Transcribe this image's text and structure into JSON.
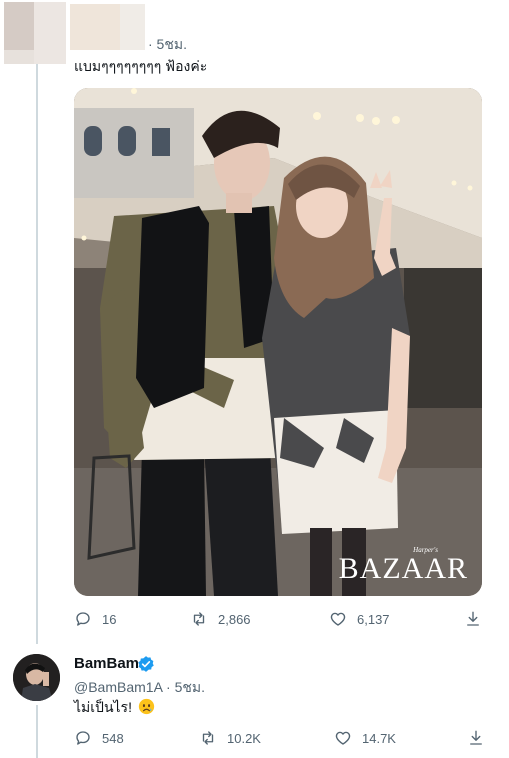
{
  "tweet1": {
    "time": "· 5ชม.",
    "text": "แบมๆๆๆๆๆๆๆๆ ฟ้องค่ะ",
    "image_watermark": "BAZAAR",
    "image_watermark_small": "Harper's",
    "actions": {
      "reply_count": "16",
      "retweet_count": "2,866",
      "like_count": "6,137"
    }
  },
  "tweet2": {
    "name": "BamBam",
    "handle_time": "@BamBam1A · 5ชม.",
    "text": "ไม่เป็นไร!",
    "actions": {
      "reply_count": "548",
      "retweet_count": "10.2K",
      "like_count": "14.7K"
    }
  },
  "colors": {
    "text_primary": "#0f1419",
    "text_secondary": "#536471",
    "verified_blue": "#1d9bf0",
    "thread_line": "#cfd9de"
  },
  "icons": [
    "reply-icon",
    "retweet-icon",
    "like-icon",
    "share-icon",
    "verified-badge-icon"
  ]
}
